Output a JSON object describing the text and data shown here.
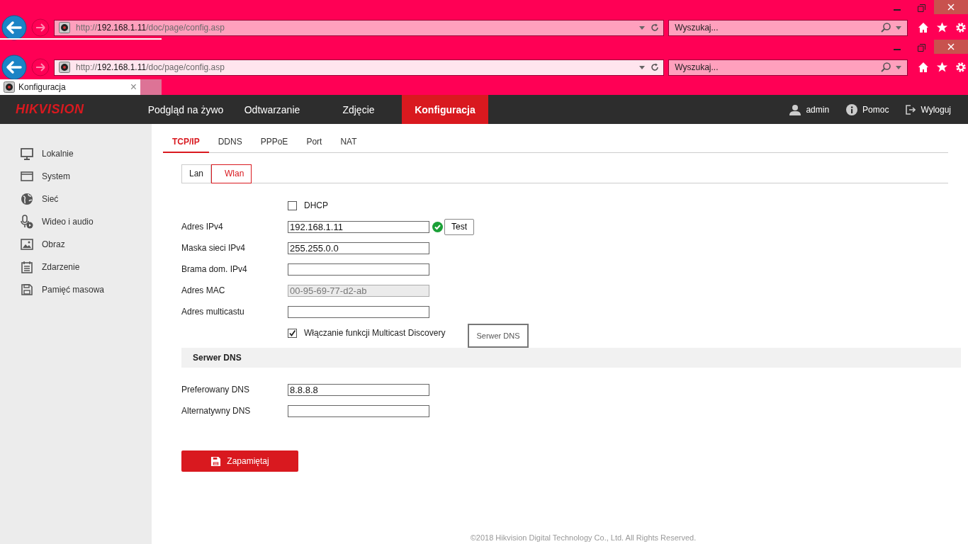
{
  "browser_windows": [
    {
      "focused": false,
      "address": {
        "scheme": "http://",
        "host": "192.168.1.11",
        "path": "/doc/page/config.asp"
      },
      "search": {
        "placeholder": "Wyszukaj..."
      }
    },
    {
      "focused": true,
      "address": {
        "scheme": "http://",
        "host": "192.168.1.11",
        "path": "/doc/page/config.asp"
      },
      "search": {
        "placeholder": "Wyszukaj..."
      }
    }
  ],
  "browser_tabs": [
    {
      "label": "Konfiguracja",
      "close": "×",
      "selected": true
    }
  ],
  "header": {
    "logo": "HIKVISION",
    "nav": [
      {
        "label": "Podgląd na żywo",
        "selected": false
      },
      {
        "label": "Odtwarzanie",
        "selected": false
      },
      {
        "label": "Zdjęcie",
        "selected": false
      },
      {
        "label": "Konfiguracja",
        "selected": true
      }
    ],
    "user_menu": [
      {
        "kind": "user",
        "label": "admin"
      },
      {
        "kind": "help",
        "label": "Pomoc"
      },
      {
        "kind": "logout",
        "label": "Wyloguj"
      }
    ]
  },
  "sidebar": {
    "items": [
      {
        "kind": "monitor",
        "label": "Lokalnie"
      },
      {
        "kind": "window",
        "label": "System"
      },
      {
        "kind": "globe",
        "label": "Sieć"
      },
      {
        "kind": "mic",
        "label": "Wideo i audio"
      },
      {
        "kind": "image",
        "label": "Obraz"
      },
      {
        "kind": "calendar",
        "label": "Zdarzenie"
      },
      {
        "kind": "disk",
        "label": "Pamięć masowa"
      }
    ]
  },
  "tabs": [
    {
      "label": "TCP/IP",
      "selected": true
    },
    {
      "label": "DDNS",
      "selected": false
    },
    {
      "label": "PPPoE",
      "selected": false
    },
    {
      "label": "Port",
      "selected": false
    },
    {
      "label": "NAT",
      "selected": false
    }
  ],
  "subtabs": [
    {
      "label": "Lan",
      "selected": false
    },
    {
      "label": "Wlan",
      "selected": true
    }
  ],
  "form": [
    {
      "kind": "checkbox",
      "label": "DHCP",
      "checked": false
    },
    {
      "kind": "input",
      "label": "Adres IPv4",
      "value": "192.168.1.11",
      "valid": true,
      "button": "Test"
    },
    {
      "kind": "input",
      "label": "Maska sieci IPv4",
      "value": "255.255.0.0"
    },
    {
      "kind": "input",
      "label": "Brama dom. IPv4"
    },
    {
      "kind": "input",
      "label": "Adres MAC",
      "value": "00-95-69-77-d2-ab",
      "disabled": true
    },
    {
      "kind": "input",
      "label": "Adres multicastu"
    },
    {
      "kind": "checkbox",
      "label": "Włączanie funkcji Multicast Discovery",
      "checked": true
    }
  ],
  "tooltip": "Serwer DNS",
  "dns": {
    "title": "Serwer DNS",
    "fields": [
      {
        "label": "Preferowany DNS",
        "value": "8.8.8.8"
      },
      {
        "label": "Alternatywny DNS"
      }
    ]
  },
  "save_button": "Zapamiętaj",
  "footer": "©2018 Hikvision Digital Technology Co., Ltd. All Rights Reserved."
}
